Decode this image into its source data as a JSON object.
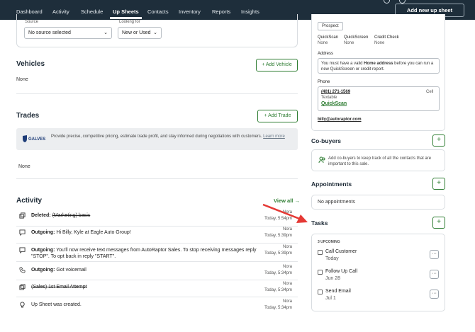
{
  "nav": {
    "tabs": [
      "Dashboard",
      "Activity",
      "Schedule",
      "Up Sheets",
      "Contacts",
      "Inventory",
      "Reports",
      "Insights"
    ],
    "active_tab": "Up Sheets",
    "new_upsheet_label": "Add new up sheet"
  },
  "source": {
    "label": "Source",
    "value": "No source selected",
    "looking_label": "Looking for",
    "looking_value": "New or Used"
  },
  "vehicles": {
    "title": "Vehicles",
    "add_label": "+ Add Vehicle",
    "empty": "None"
  },
  "trades": {
    "title": "Trades",
    "add_label": "+ Add Trade",
    "galves_text": "Provide precise, competitive pricing, estimate trade profit, and stay informed during negotiations with customers.",
    "galves_link": "Learn more",
    "galves_logo": "GALVES",
    "empty": "None"
  },
  "activity": {
    "title": "Activity",
    "view_all": "View all →",
    "items": [
      {
        "icon": "copy-icon",
        "prefix": "Deleted:",
        "text": "(Marketing) basic",
        "strike": true,
        "who": "Nora",
        "time": "Today, 5:54pm"
      },
      {
        "icon": "message-icon",
        "prefix": "Outgoing:",
        "text": "Hi Billy, Kyle at Eagle Auto Group!",
        "strike": false,
        "who": "Nora",
        "time": "Today, 5:39pm"
      },
      {
        "icon": "message-icon",
        "prefix": "Outgoing:",
        "text": "You'll now receive text messages from AutoRaptor Sales. To stop receiving messages reply \"STOP\". To opt back in reply \"START\".",
        "strike": false,
        "who": "Nora",
        "time": "Today, 5:39pm"
      },
      {
        "icon": "phone-icon",
        "prefix": "Outgoing:",
        "text": "Got voicemail",
        "strike": false,
        "who": "Nora",
        "time": "Today, 5:34pm"
      },
      {
        "icon": "copy-icon",
        "prefix": "",
        "text": "(Sales) 1st Email Attempt",
        "strike": true,
        "who": "Nora",
        "time": "Today, 5:34pm"
      },
      {
        "icon": "lightbulb-icon",
        "prefix": "",
        "text": "Up Sheet was created.",
        "strike": false,
        "who": "Nora",
        "time": "Today, 5:34pm"
      }
    ]
  },
  "contact": {
    "badge": "Prospect",
    "quickscan_label": "QuickScan",
    "quickscan_val": "None",
    "quickscreen_label": "QuickScreen",
    "quickscreen_val": "None",
    "credit_label": "Credit Check",
    "credit_val": "None",
    "address_label": "Address",
    "address_msg_pre": "You must have a valid ",
    "address_msg_bold": "Home address",
    "address_msg_post": " before you can run a new QuickScreen or credit report.",
    "phone_label": "Phone",
    "phone_number": "(401) 271-1569",
    "phone_type": "Cell",
    "phone_textable": "Textable",
    "phone_quickscan": "QuickScan",
    "email": "billy@autoraptor.com"
  },
  "cobuyers": {
    "title": "Co-buyers",
    "text": "Add co-buyers to keep track of all the contacts that are important to this sale."
  },
  "appointments": {
    "title": "Appointments",
    "empty": "No appointments"
  },
  "tasks": {
    "title": "Tasks",
    "upcoming_label": "3 UPCOMING",
    "items": [
      {
        "name": "Call Customer",
        "due": "Today"
      },
      {
        "name": "Follow Up Call",
        "due": "Jun 28"
      },
      {
        "name": "Send Email",
        "due": "Jul 1"
      }
    ]
  },
  "colors": {
    "nav_bg": "#1e2e3b",
    "accent_green": "#2e7d32",
    "arrow_red": "#e53935"
  }
}
